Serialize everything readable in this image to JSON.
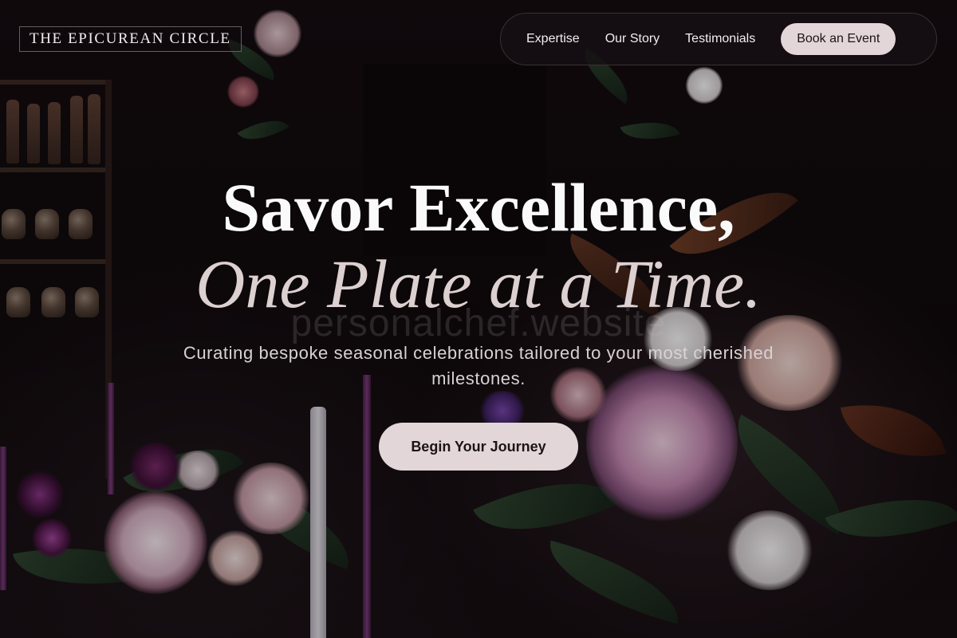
{
  "brand": {
    "logo_text": "THE EPICUREAN CIRCLE"
  },
  "nav": {
    "links": [
      "Expertise",
      "Our Story",
      "Testimonials"
    ],
    "cta_label": "Book an Event"
  },
  "hero": {
    "headline_line1": "Savor Excellence,",
    "headline_line2": "One Plate at a Time.",
    "watermark": "personalchef.website",
    "subtitle": "Curating bespoke seasonal celebrations tailored to your most cherished milestones.",
    "cta_label": "Begin Your Journey"
  },
  "colors": {
    "background": "#0f0a0c",
    "button_bg": "#e3d6d8",
    "button_text": "#1c1416",
    "accent_blush": "#ddd0d1"
  }
}
